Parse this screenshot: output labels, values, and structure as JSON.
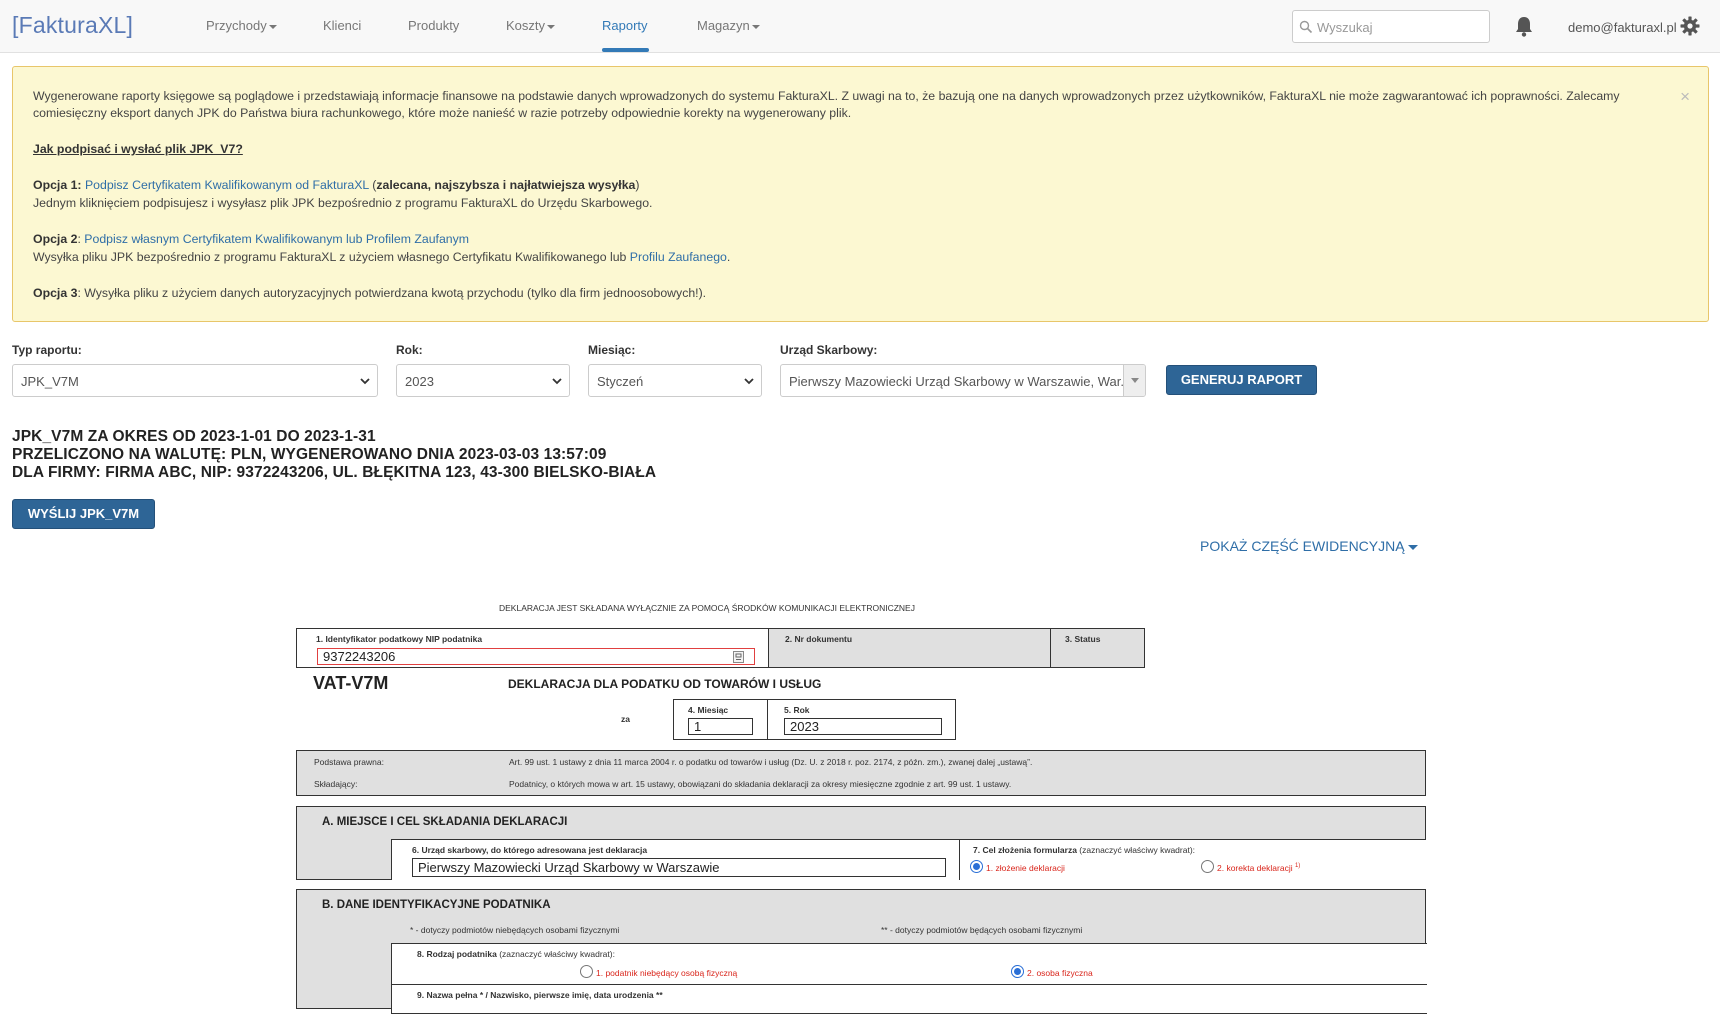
{
  "app": {
    "brand": "[FakturaXL]"
  },
  "nav": {
    "items": [
      {
        "label": "Przychody",
        "dropdown": true
      },
      {
        "label": "Klienci",
        "dropdown": false
      },
      {
        "label": "Produkty",
        "dropdown": false
      },
      {
        "label": "Koszty",
        "dropdown": true
      },
      {
        "label": "Raporty",
        "dropdown": false,
        "active": true
      },
      {
        "label": "Magazyn",
        "dropdown": true
      }
    ],
    "search_placeholder": "Wyszukaj",
    "user_email": "demo@fakturaxl.pl",
    "icons": [
      "search-icon",
      "bell-icon",
      "gear-icon"
    ]
  },
  "alert": {
    "intro_line1": "Wygenerowane raporty księgowe są poglądowe i przedstawiają informacje finansowe na podstawie danych wprowadzonych do systemu FakturaXL. Z uwagi na to, że bazują one na danych wprowadzonych przez użytkowników, FakturaXL nie może zagwarantować ich poprawności. Zalecamy",
    "intro_line2": "comiesięczny eksport danych JPK do Państwa biura rachunkowego, które może nanieść w razie potrzeby odpowiednie korekty na wygenerowany plik.",
    "howto_link": "Jak podpisać i wysłać plik JPK_V7?",
    "opt1_label": "Opcja 1:",
    "opt1_link": "Podpisz Certyfikatem Kwalifikowanym od FakturaXL",
    "opt1_note": "zalecana, najszybsza i najłatwiejsza wysyłka",
    "opt1_desc": "Jednym kliknięciem podpisujesz i wysyłasz plik JPK bezpośrednio z programu FakturaXL do Urzędu Skarbowego.",
    "opt2_label": "Opcja 2",
    "opt2_link": "Podpisz własnym Certyfikatem Kwalifikowanym lub Profilem Zaufanym",
    "opt2_desc": "Wysyłka pliku JPK bezpośrednio z programu FakturaXL z użyciem własnego Certyfikatu Kwalifikowanego lub",
    "opt2_desc_link": "Profilu Zaufanego",
    "opt3_label": "Opcja 3",
    "opt3_desc": ": Wysyłka pliku z użyciem danych autoryzacyjnych potwierdzana kwotą przychodu (tylko dla firm jednoosobowych!).",
    "close": "×"
  },
  "filters": {
    "report_type_label": "Typ raportu:",
    "report_type_value": "JPK_V7M",
    "year_label": "Rok:",
    "year_value": "2023",
    "month_label": "Miesiąc:",
    "month_value": "Styczeń",
    "office_label": "Urząd Skarbowy:",
    "office_value": "Pierwszy Mazowiecki Urząd Skarbowy w Warszawie, War...",
    "generate_button": "GENERUJ RAPORT"
  },
  "report": {
    "line1": "JPK_V7M ZA OKRES OD 2023-1-01 DO 2023-1-31",
    "line2": "PRZELICZONO NA WALUTĘ: PLN, WYGENEROWANO DNIA 2023-03-03 13:57:09",
    "line3": "DLA FIRMY: FIRMA ABC, NIP: 9372243206, UL. BŁĘKITNA 123, 43-300 BIELSKO-BIAŁA",
    "send_button": "WYŚLIJ JPK_V7M",
    "toggle_link": "POKAŻ CZĘŚĆ EWIDENCYJNĄ"
  },
  "form": {
    "header_note": "DEKLARACJA JEST SKŁADANA WYŁĄCZNIE ZA POMOCĄ ŚRODKÓW KOMUNIKACJI ELEKTRONICZNEJ",
    "f1_label": "1. Identyfikator podatkowy NIP podatnika",
    "f1_value": "9372243206",
    "f2_label": "2. Nr dokumentu",
    "f3_label": "3. Status",
    "form_code": "VAT-V7M",
    "form_title": "DEKLARACJA DLA PODATKU OD TOWARÓW I USŁUG",
    "za": "za",
    "f4_label": "4. Miesiąc",
    "f4_value": "1",
    "f5_label": "5. Rok",
    "f5_value": "2023",
    "legal_basis_label": "Podstawa prawna:",
    "legal_basis_text": "Art. 99 ust. 1 ustawy z dnia 11 marca 2004 r. o podatku od towarów i usług (Dz. U. z 2018 r. poz. 2174, z późn. zm.), zwanej dalej „ustawą”.",
    "filer_label": "Składający:",
    "filer_text": "Podatnicy, o których mowa w art. 15 ustawy, obowiązani do składania deklaracji za okresy miesięczne zgodnie z art. 99 ust. 1 ustawy.",
    "section_a": "A. MIEJSCE I CEL SKŁADANIA DEKLARACJI",
    "f6_label": "6. Urząd skarbowy, do którego adresowana jest deklaracja",
    "f6_value": "Pierwszy Mazowiecki Urząd Skarbowy w Warszawie",
    "f7_label_bold": "7. Cel złożenia formularza",
    "f7_label_note": "(zaznaczyć właściwy kwadrat):",
    "f7_opt1": "1. złożenie deklaracji",
    "f7_opt2": "2. korekta deklaracji",
    "f7_opt2_sup": "1)",
    "section_b": "B. DANE IDENTYFIKACYJNE PODATNIKA",
    "note_star": "* - dotyczy podmiotów niebędących osobami fizycznymi",
    "note_dstar": "** - dotyczy podmiotów będących osobami fizycznymi",
    "f8_label_bold": "8. Rodzaj podatnika",
    "f8_label_note": "(zaznaczyć właściwy kwadrat):",
    "f8_opt1": "1. podatnik niebędący osobą fizyczną",
    "f8_opt2": "2. osoba fizyczna",
    "f9_label": "9. Nazwa pełna * / Nazwisko, pierwsze imię, data urodzenia **"
  }
}
